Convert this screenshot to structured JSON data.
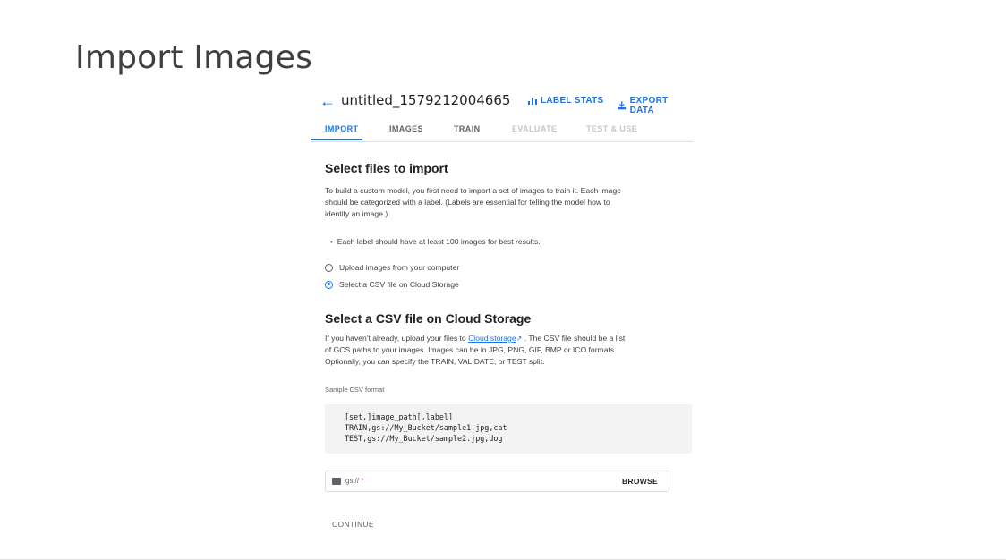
{
  "slide": {
    "title": "Import Images"
  },
  "header": {
    "back_icon": "back-arrow-icon",
    "dataset_name": "untitled_1579212004665",
    "label_stats": "LABEL STATS",
    "export_data": "EXPORT DATA"
  },
  "tabs": [
    {
      "label": "IMPORT",
      "state": "active"
    },
    {
      "label": "IMAGES",
      "state": "normal"
    },
    {
      "label": "TRAIN",
      "state": "normal"
    },
    {
      "label": "EVALUATE",
      "state": "disabled"
    },
    {
      "label": "TEST & USE",
      "state": "disabled"
    }
  ],
  "select_files": {
    "heading": "Select files to import",
    "description_line1": "To build a custom model, you first need to import a set of images to train it. Each image",
    "description_line2": "should be categorized with a label. (Labels are essential for telling the model how to",
    "description_line3": "identify an image.)",
    "bullet": "Each label should have at least 100 images for best results.",
    "options": [
      {
        "label": "Upload images from your computer",
        "checked": false
      },
      {
        "label": "Select a CSV file on Cloud Storage",
        "checked": true
      }
    ]
  },
  "csv_section": {
    "heading": "Select a CSV file on Cloud Storage",
    "line1_pre": "If you haven't already, upload your files to ",
    "line1_link": "Cloud storage",
    "line1_post": " . The CSV file should be a list",
    "line2": "of GCS paths to your images. Images can be in JPG, PNG, GIF, BMP or ICO formats.",
    "line3": "Optionally, you can specify the TRAIN, VALIDATE, or TEST split.",
    "sample_caption": "Sample CSV format",
    "code_lines": [
      "[set,]image_path[,label]",
      "TRAIN,gs://My_Bucket/sample1.jpg,cat",
      "TEST,gs://My_Bucket/sample2.jpg,dog"
    ]
  },
  "path_input": {
    "prefix": "gs://",
    "required_mark": "*",
    "browse_label": "BROWSE"
  },
  "continue_label": "CONTINUE",
  "colors": {
    "accent": "#1a73e8",
    "text": "#202124",
    "muted": "#5f6368",
    "code_bg": "#f3f3f3"
  }
}
